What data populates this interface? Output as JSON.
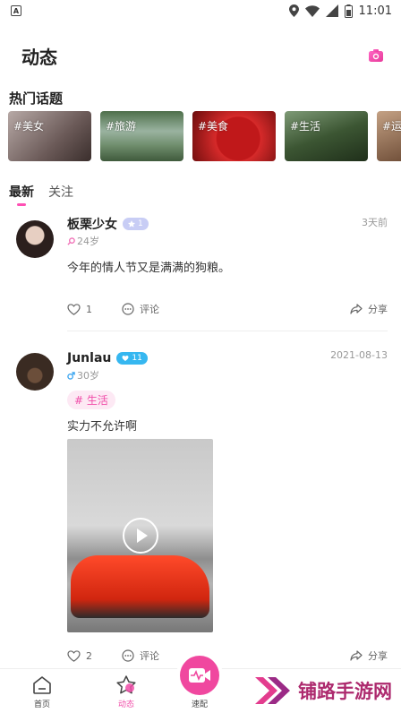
{
  "status_bar": {
    "time": "11:01"
  },
  "header": {
    "title": "动态"
  },
  "hot_topics": {
    "title": "热门话题",
    "items": [
      {
        "label": "#美女"
      },
      {
        "label": "#旅游"
      },
      {
        "label": "#美食"
      },
      {
        "label": "#生活"
      },
      {
        "label": "#运"
      }
    ]
  },
  "tabs": [
    {
      "label": "最新",
      "active": true
    },
    {
      "label": "关注",
      "active": false
    }
  ],
  "posts": [
    {
      "name": "板栗少女",
      "level": "1",
      "time": "3天前",
      "age": "24岁",
      "content": "今年的情人节又是满满的狗粮。",
      "likes": "1",
      "comment_label": "评论",
      "share_label": "分享"
    },
    {
      "name": "Junlau",
      "level": "11",
      "time": "2021-08-13",
      "age": "30岁",
      "tag": "# 生活",
      "content": "实力不允许啊",
      "likes": "2",
      "comment_label": "评论",
      "share_label": "分享"
    }
  ],
  "bottom_nav": {
    "items": [
      {
        "label": "首页"
      },
      {
        "label": "动态"
      },
      {
        "label": "速配"
      }
    ]
  },
  "watermark": {
    "text": "铺路手游网"
  },
  "colors": {
    "accent": "#f04ca8",
    "level_blue": "#36b7f0"
  }
}
